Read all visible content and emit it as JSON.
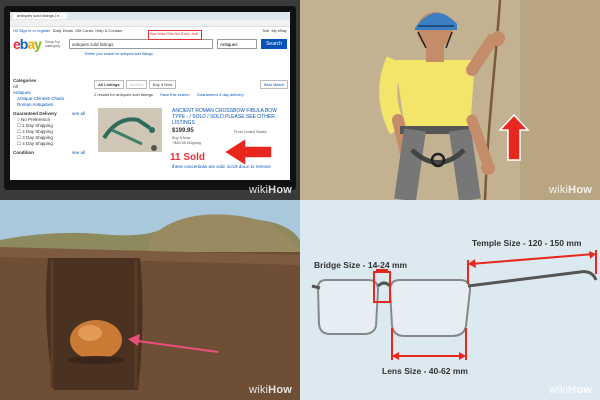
{
  "watermark": {
    "brand_prefix": "wiki",
    "brand_suffix": "How"
  },
  "panel1": {
    "tabs": [
      "antiques sold listings | e...",
      "eBay"
    ],
    "top_left": [
      "Hi! Sign in or register",
      "Daily Deals",
      "Gift Cards",
      "Help & Contact"
    ],
    "top_right": [
      "Sell",
      "My eBay"
    ],
    "banner": "Star Wars Gifts Not Every Jedi!",
    "logo": [
      "e",
      "b",
      "a",
      "y"
    ],
    "shop_by": "Shop by category",
    "search_value": "antiques sold listings",
    "category": "Antiques",
    "search_button": "Search",
    "refine": "Refine your search for antiques sold listings",
    "sidebar": {
      "categories_heading": "Categories",
      "all": "All",
      "antiques": "Antiques",
      "sub_items": [
        "Antique Chinese Chairs",
        "Roman Antiquities"
      ],
      "delivery_heading": "Guaranteed Delivery",
      "see_all": "see all",
      "delivery_items": [
        "No Preference",
        "1 Day Shipping",
        "2 Day Shipping",
        "3 Day Shipping",
        "4 Day Shipping"
      ],
      "condition_heading": "Condition",
      "condition_see_all": "see all"
    },
    "result_tabs": [
      "All Listings",
      "Auction",
      "Buy It Now"
    ],
    "best_match": "Best Match",
    "result_count": "2 results for antiques sold listings",
    "save_search": "Save this search",
    "delivery_note": "Guaranteed 3 day delivery",
    "item": {
      "title": "ANCIENT ROMAN CROSSBOW FIBULA BOW TYPE - / SOLD / SOLD PLEASE SEE OTHER LISTINGS",
      "price": "$199.95",
      "buy_it_now": "Buy It Now",
      "shipping": "+$30.95 shipping",
      "location": "From United States",
      "sold": "11 Sold",
      "caption": "these concertinas are sold. scroll down to remove"
    }
  },
  "panel4": {
    "bridge_label": "Bridge Size - 14-24 mm",
    "temple_label": "Temple Size - 120 - 150 mm",
    "lens_label": "Lens Size - 40-62 mm",
    "accent": "#e8281e"
  }
}
